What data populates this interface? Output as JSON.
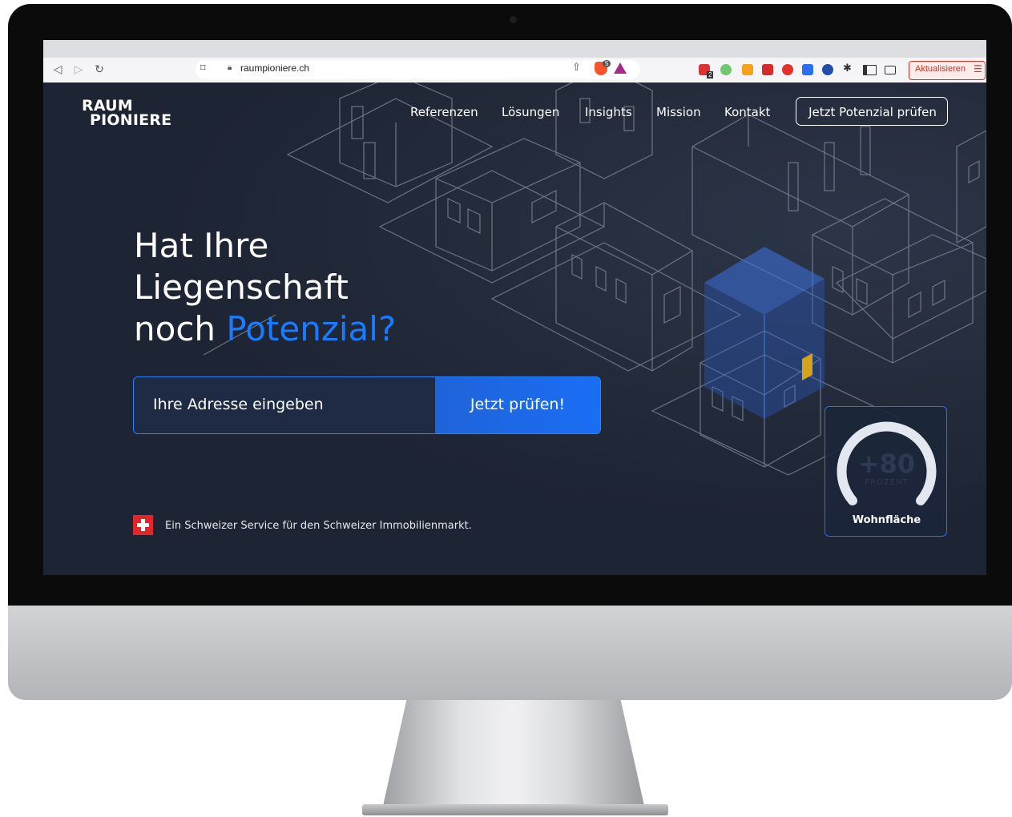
{
  "browser": {
    "url": "raumpioniere.ch",
    "update_button": "Aktualisieren",
    "brave_badge": "5",
    "extension_badge": "2",
    "nav_icons": [
      "back-icon",
      "forward-icon",
      "reload-icon"
    ]
  },
  "site": {
    "logo_line1": "RAUM",
    "logo_line2": "PIONIERE",
    "nav": [
      "Referenzen",
      "Lösungen",
      "Insights",
      "Mission",
      "Kontakt"
    ],
    "cta": "Jetzt Potenzial prüfen",
    "headline_line1": "Hat Ihre",
    "headline_line2": "Liegenschaft",
    "headline_line3_prefix": "noch ",
    "headline_accent": "Potenzial?",
    "address_placeholder": "Ihre Adresse eingeben",
    "check_button": "Jetzt prüfen!",
    "service_text": "Ein Schweizer Service für den Schweizer Immobilienmarkt.",
    "gauge": {
      "value": "+80",
      "unit": "PROZENT",
      "label": "Wohnfläche"
    }
  },
  "colors": {
    "accent": "#1a7bff",
    "background": "#1d2433",
    "swiss_red": "#e4252a",
    "update_red": "#d93025"
  }
}
